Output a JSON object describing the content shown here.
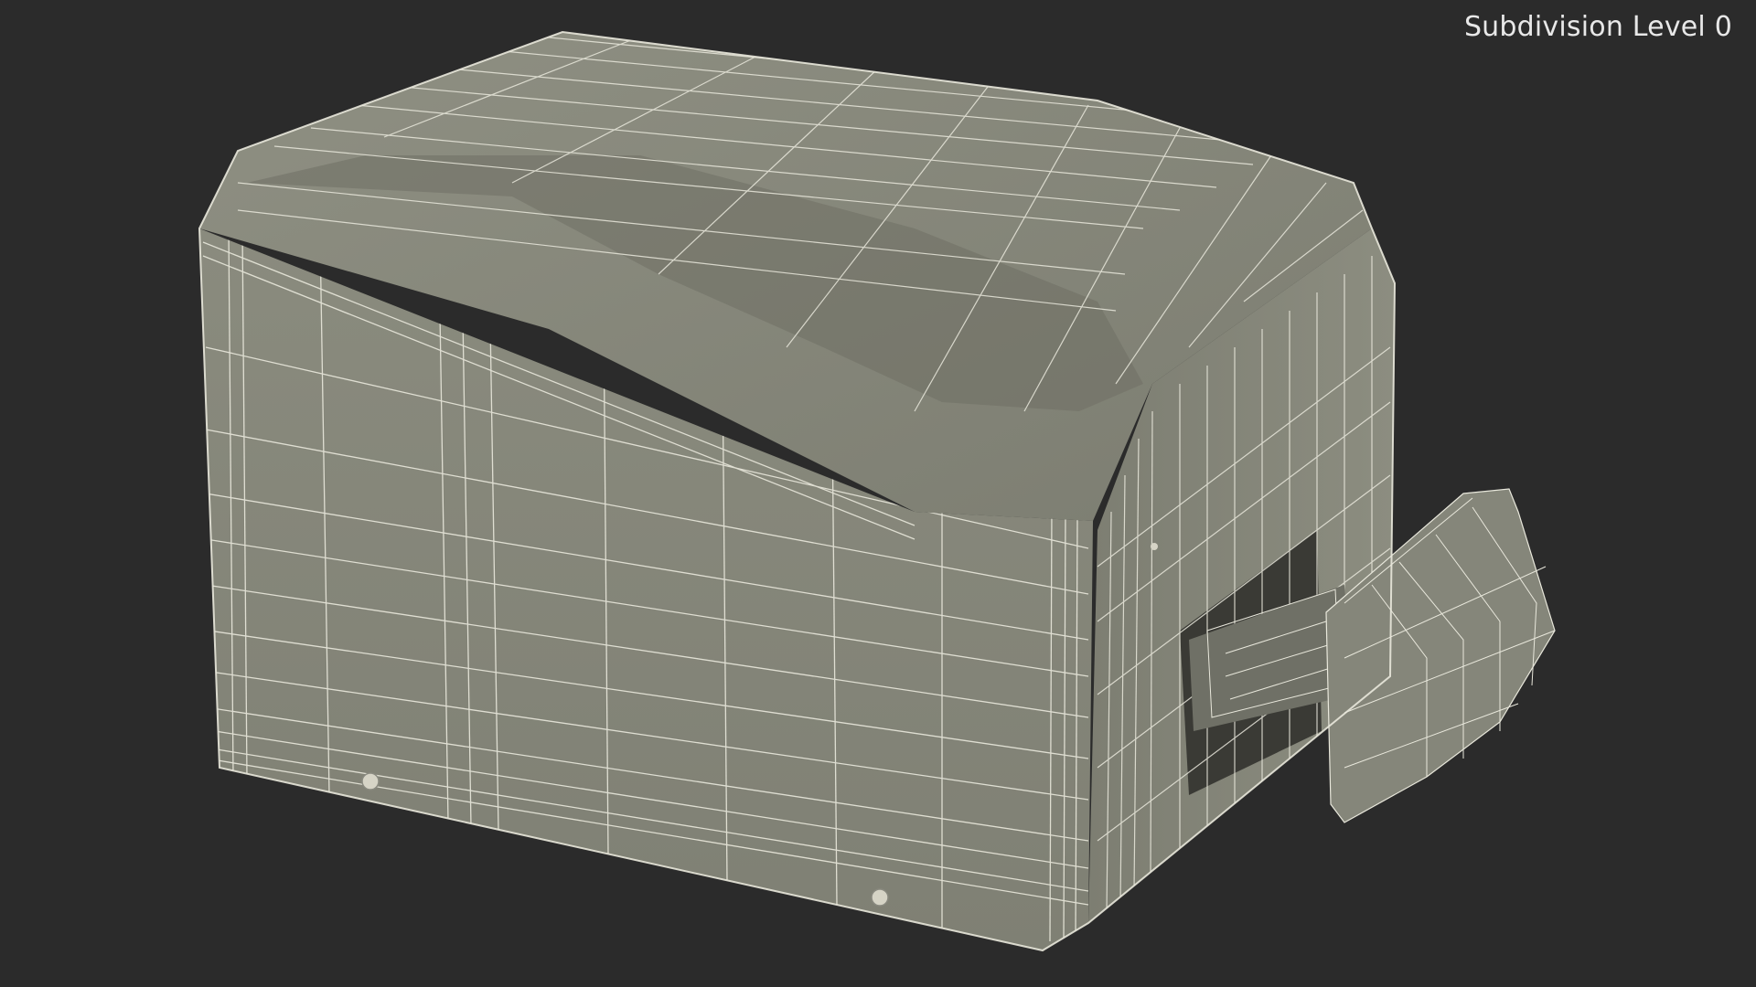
{
  "viewport": {
    "overlay_label": "Subdivision Level 0",
    "colors": {
      "background": "#2b2b2b",
      "surface_light": "#8d8e80",
      "surface_mid": "#7b7c6f",
      "surface_dark": "#66675c",
      "wire": "#e9e8dc",
      "label": "#e8e8e8"
    },
    "model_name": "printer-wireframe-model"
  }
}
